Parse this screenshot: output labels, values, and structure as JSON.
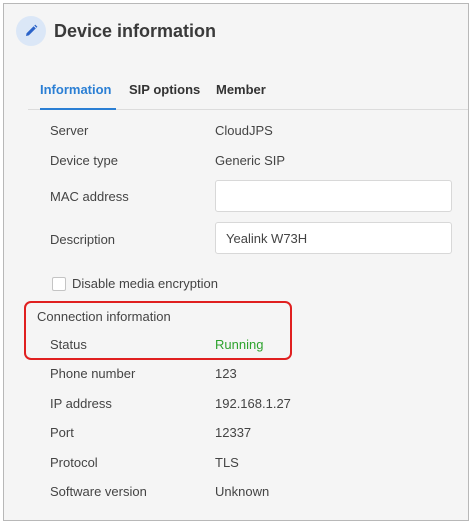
{
  "header": {
    "title": "Device information",
    "icon": "pencil-icon"
  },
  "tabs": [
    {
      "label": "Information",
      "active": true
    },
    {
      "label": "SIP options",
      "active": false
    },
    {
      "label": "Member",
      "active": false
    }
  ],
  "fields": {
    "server": {
      "label": "Server",
      "value": "CloudJPS"
    },
    "device_type": {
      "label": "Device type",
      "value": "Generic SIP"
    },
    "mac_address": {
      "label": "MAC address",
      "value": ""
    },
    "description": {
      "label": "Description",
      "value": "Yealink W73H"
    }
  },
  "encryption": {
    "label": "Disable media encryption",
    "checked": false
  },
  "connection": {
    "title": "Connection information",
    "status": {
      "label": "Status",
      "value": "Running",
      "color": "#2ea32e"
    },
    "phone_number": {
      "label": "Phone number",
      "value": "123"
    },
    "ip_address": {
      "label": "IP address",
      "value": "192.168.1.27"
    },
    "port": {
      "label": "Port",
      "value": "12337"
    },
    "protocol": {
      "label": "Protocol",
      "value": "TLS"
    },
    "software_version": {
      "label": "Software version",
      "value": "Unknown"
    }
  },
  "colors": {
    "accent": "#2b7fd4",
    "highlight": "#e02020"
  }
}
